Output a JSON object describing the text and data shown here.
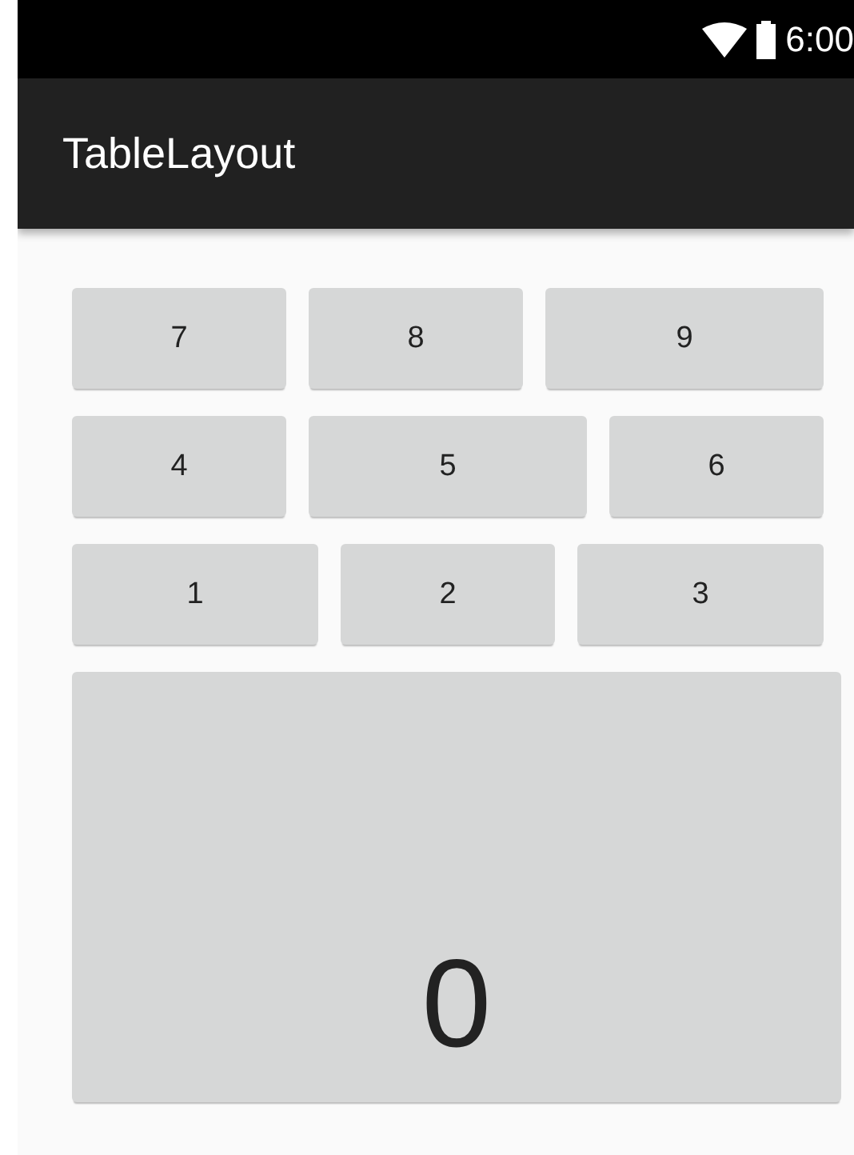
{
  "status_bar": {
    "time": "6:00"
  },
  "toolbar": {
    "title": "TableLayout"
  },
  "rows": [
    [
      "7",
      "8",
      "9"
    ],
    [
      "4",
      "5",
      "6"
    ],
    [
      "1",
      "2",
      "3"
    ]
  ],
  "big_button": "0"
}
